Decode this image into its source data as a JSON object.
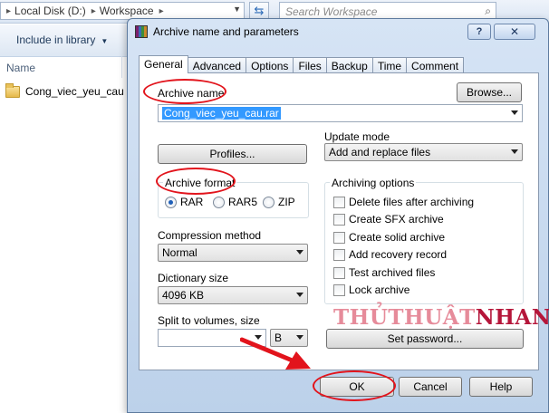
{
  "explorer": {
    "breadcrumb": [
      "Local Disk (D:)",
      "Workspace"
    ],
    "search_placeholder": "Search Workspace",
    "include_in_library": "Include in library",
    "column_name": "Name",
    "folder": "Cong_viec_yeu_cau"
  },
  "dialog": {
    "title": "Archive name and parameters",
    "help_glyph": "?",
    "close_glyph": "✕",
    "tabs": [
      "General",
      "Advanced",
      "Options",
      "Files",
      "Backup",
      "Time",
      "Comment"
    ],
    "archive_name_label": "Archive name",
    "browse_label": "Browse...",
    "archive_name_value": "Cong_viec_yeu_cau.rar",
    "update_mode_label": "Update mode",
    "update_mode_value": "Add and replace files",
    "profiles_label": "Profiles...",
    "archive_format_label": "Archive format",
    "formats": [
      {
        "label": "RAR",
        "selected": true
      },
      {
        "label": "RAR5",
        "selected": false
      },
      {
        "label": "ZIP",
        "selected": false
      }
    ],
    "archiving_options_label": "Archiving options",
    "options": [
      {
        "label": "Delete files after archiving",
        "checked": false
      },
      {
        "label": "Create SFX archive",
        "checked": false
      },
      {
        "label": "Create solid archive",
        "checked": false
      },
      {
        "label": "Add recovery record",
        "checked": false
      },
      {
        "label": "Test archived files",
        "checked": false
      },
      {
        "label": "Lock archive",
        "checked": false
      }
    ],
    "compression_method_label": "Compression method",
    "compression_method_value": "Normal",
    "dictionary_size_label": "Dictionary size",
    "dictionary_size_value": "4096 KB",
    "split_label": "Split to volumes, size",
    "split_value": "",
    "split_unit": "B",
    "set_password_label": "Set password...",
    "ok_label": "OK",
    "cancel_label": "Cancel",
    "help_label": "Help"
  },
  "watermark": {
    "part1": "THỦTHUẬT",
    "part2": "NHANH"
  },
  "colors": {
    "annotation_red": "#e2141c",
    "selection_blue": "#3399ff"
  }
}
